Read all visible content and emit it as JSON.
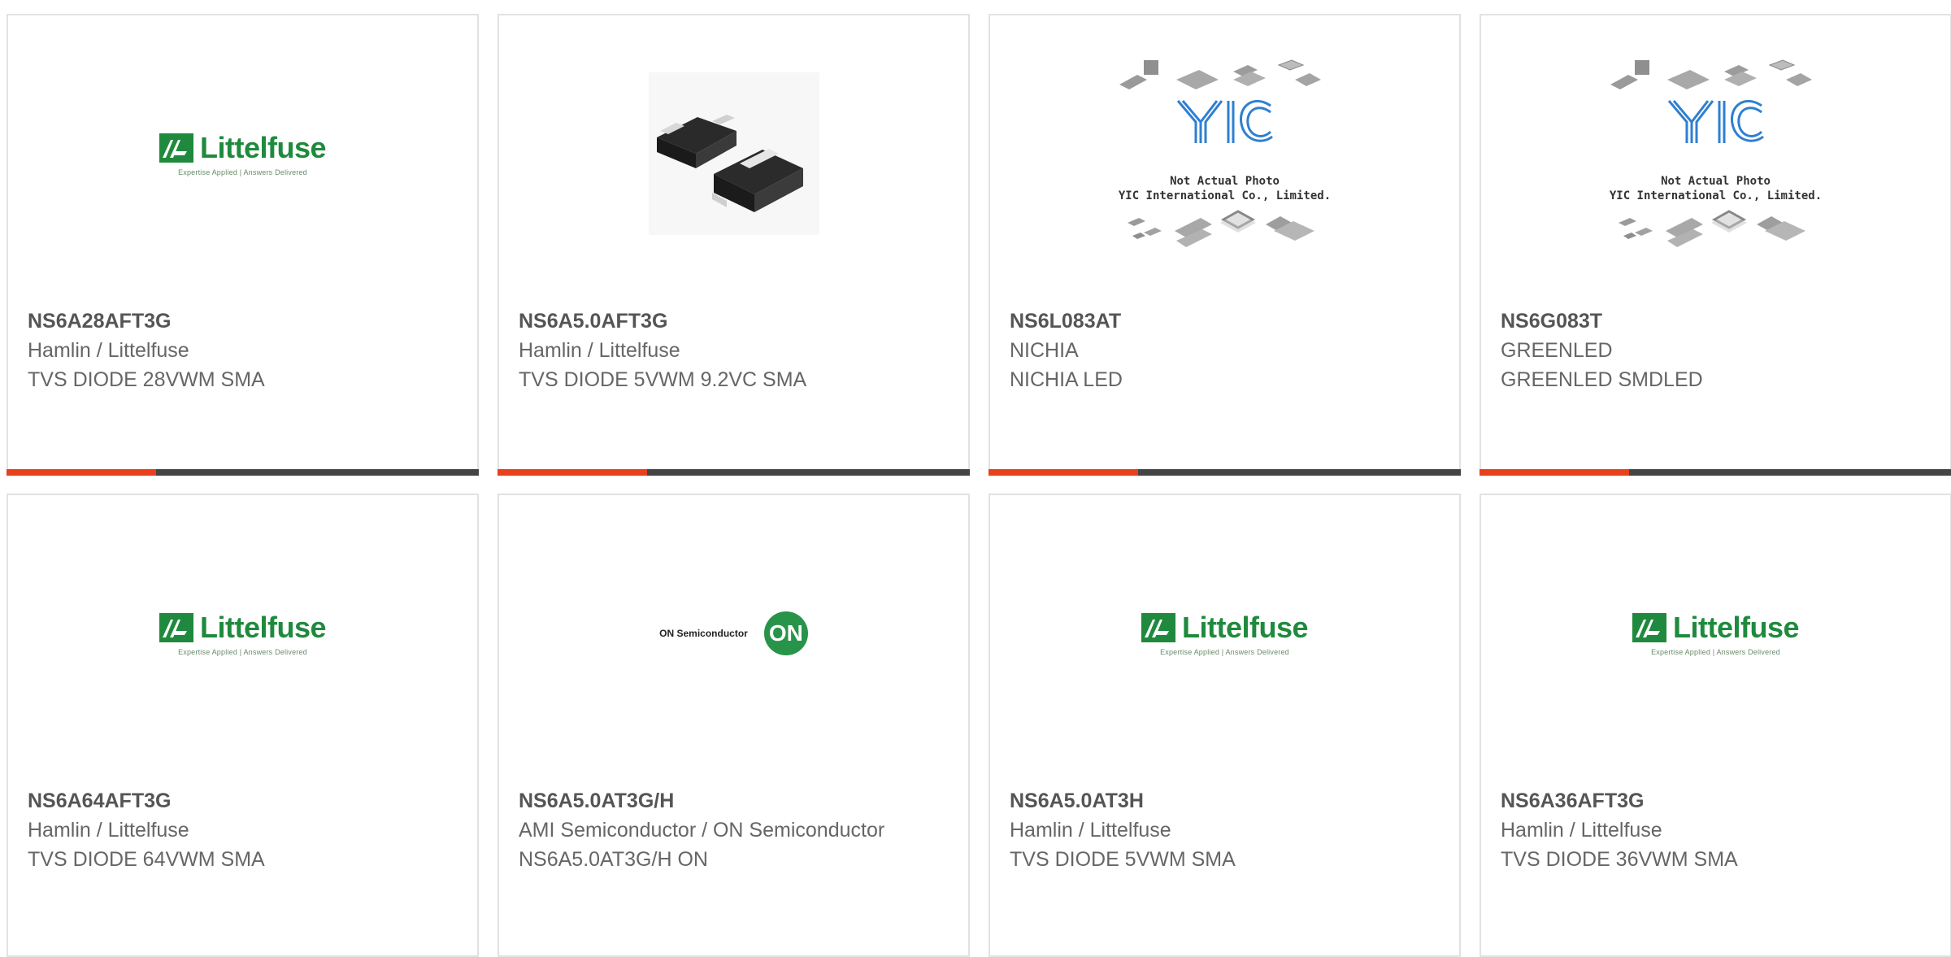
{
  "colors": {
    "accent": "#e8401c",
    "bar_dark": "#444444",
    "littelfuse_green": "#1f8a3d",
    "on_green": "#27944a",
    "yic_blue": "#2f7fd0"
  },
  "cards": [
    {
      "part_number": "NS6A28AFT3G",
      "manufacturer": "Hamlin / Littelfuse",
      "description": "TVS DIODE 28VWM SMA",
      "image": "littelfuse-logo"
    },
    {
      "part_number": "NS6A5.0AFT3G",
      "manufacturer": "Hamlin / Littelfuse",
      "description": "TVS DIODE 5VWM 9.2VC SMA",
      "image": "sma-package-photo"
    },
    {
      "part_number": "NS6L083AT",
      "manufacturer": "NICHIA",
      "description": "NICHIA LED",
      "image": "yic-placeholder"
    },
    {
      "part_number": "NS6G083T",
      "manufacturer": "GREENLED",
      "description": "GREENLED SMDLED",
      "image": "yic-placeholder"
    },
    {
      "part_number": "NS6A64AFT3G",
      "manufacturer": "Hamlin / Littelfuse",
      "description": "TVS DIODE 64VWM SMA",
      "image": "littelfuse-logo"
    },
    {
      "part_number": "NS6A5.0AT3G/H",
      "manufacturer": "AMI Semiconductor / ON Semiconductor",
      "description": "NS6A5.0AT3G/H ON",
      "image": "on-semiconductor-logo"
    },
    {
      "part_number": "NS6A5.0AT3H",
      "manufacturer": "Hamlin / Littelfuse",
      "description": "TVS DIODE 5VWM SMA",
      "image": "littelfuse-logo"
    },
    {
      "part_number": "NS6A36AFT3G",
      "manufacturer": "Hamlin / Littelfuse",
      "description": "TVS DIODE 36VWM SMA",
      "image": "littelfuse-logo"
    }
  ],
  "logos": {
    "littelfuse_word": "Littelfuse",
    "littelfuse_tagline": "Expertise Applied | Answers Delivered",
    "on_semi_text": "ON Semiconductor",
    "on_semi_mark": "ON",
    "yic_caption_line1": "Not Actual Photo",
    "yic_caption_line2": "YIC International Co., Limited."
  }
}
